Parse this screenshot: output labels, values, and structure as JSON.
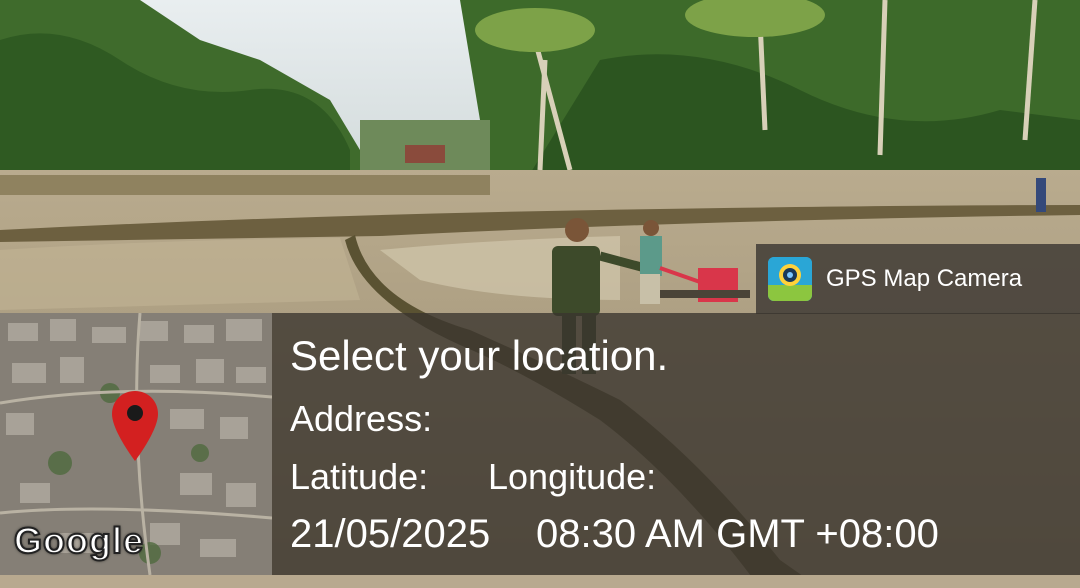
{
  "app_badge": {
    "name": "GPS Map Camera",
    "icon": "gps-map-camera-app-icon"
  },
  "map": {
    "provider_logo": "Google",
    "pin_icon": "map-pin-icon",
    "pin_color": "#d32020"
  },
  "info": {
    "title": "Select your location.",
    "address_label": "Address:",
    "latitude_label": "Latitude:",
    "longitude_label": "Longitude:",
    "date": "21/05/2025",
    "time": "08:30 AM GMT +08:00"
  }
}
